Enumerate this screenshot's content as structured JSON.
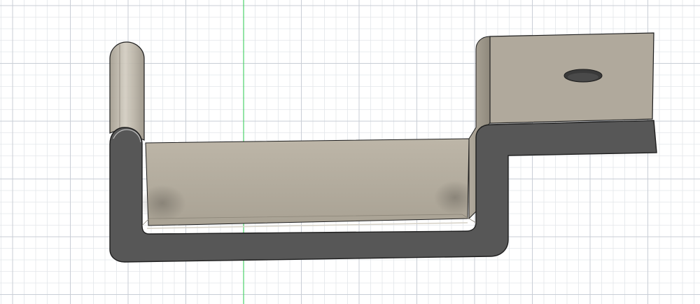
{
  "viewport": {
    "background": "#ffffff",
    "grid_minor_color": "#e3e6ea",
    "grid_major_color": "#c9ced6",
    "axis_color": "#4cd26a"
  },
  "model": {
    "face_color": "#aaa294",
    "face_highlight": "#c9c3b6",
    "side_color": "#555555",
    "edge_color": "#1e1e1e",
    "hole_color": "#3a3a3a"
  }
}
